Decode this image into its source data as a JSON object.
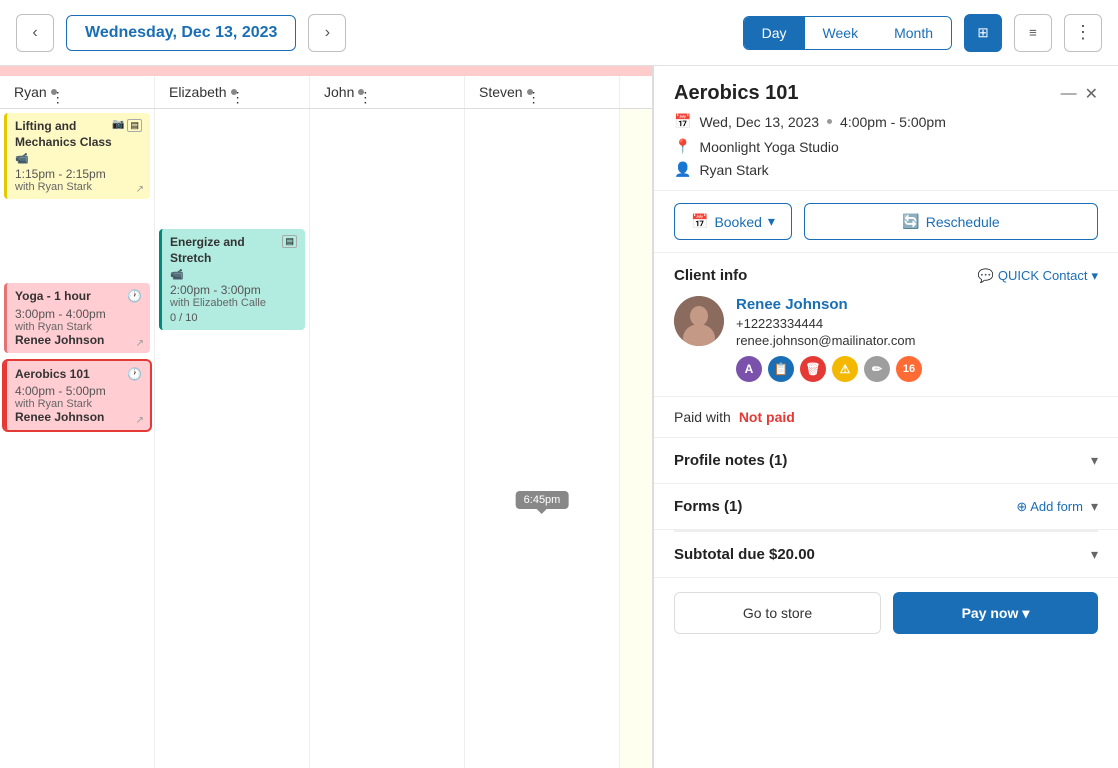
{
  "header": {
    "prev_label": "‹",
    "next_label": "›",
    "date": "Wednesday, Dec 13, 2023",
    "tabs": [
      {
        "label": "Day",
        "active": true
      },
      {
        "label": "Week",
        "active": false
      },
      {
        "label": "Month",
        "active": false
      }
    ],
    "grid_icon": "⊞",
    "list_icon": "≡",
    "more_icon": "⋮"
  },
  "columns": [
    {
      "name": "Ryan",
      "tint": false
    },
    {
      "name": "Elizabeth",
      "tint": false
    },
    {
      "name": "John",
      "tint": false
    },
    {
      "name": "Steven",
      "tint": false
    },
    {
      "name": "",
      "tint": true
    }
  ],
  "events": {
    "col0": [
      {
        "title": "Lifting and Mechanics Class",
        "icons": "📷",
        "time": "1:15pm - 2:15pm",
        "with": "with Ryan Stark",
        "color": "yellow"
      },
      {
        "title": "Yoga - 1 hour",
        "time_icon": "⏰",
        "time": "3:00pm - 4:00pm",
        "with": "with Ryan Stark",
        "client": "Renee Johnson",
        "color": "pink"
      },
      {
        "title": "Aerobics 101",
        "time_icon": "⏰",
        "time": "4:00pm - 5:00pm",
        "with": "with Ryan Stark",
        "client": "Renee Johnson",
        "color": "pink-active"
      }
    ],
    "col1": [
      {
        "title": "Energize and Stretch",
        "icons": "📷",
        "time": "2:00pm - 3:00pm",
        "with": "with Elizabeth Calle",
        "count": "0 / 10",
        "color": "teal"
      }
    ],
    "col4_tooltip": "6:45pm"
  },
  "detail": {
    "title": "Aerobics 101",
    "close_x": "✕",
    "close_dash": "—",
    "date": "Wed, Dec 13, 2023",
    "time": "4:00pm - 5:00pm",
    "location": "Moonlight Yoga Studio",
    "trainer": "Ryan Stark",
    "booked_label": "Booked",
    "reschedule_label": "Reschedule",
    "client_info_title": "Client info",
    "quick_contact": "QUICK Contact",
    "client_name": "Renee Johnson",
    "client_phone": "+12223334444",
    "client_email": "renee.johnson@mailinator.com",
    "badges": [
      "A",
      "📋",
      "🗑",
      "⚠",
      "✏",
      "16"
    ],
    "paid_label": "Paid with",
    "not_paid": "Not paid",
    "profile_notes": "Profile notes (1)",
    "forms": "Forms (1)",
    "add_form": "Add form",
    "subtotal": "Subtotal due $20.00",
    "store_btn": "Go to store",
    "pay_btn": "Pay now"
  }
}
